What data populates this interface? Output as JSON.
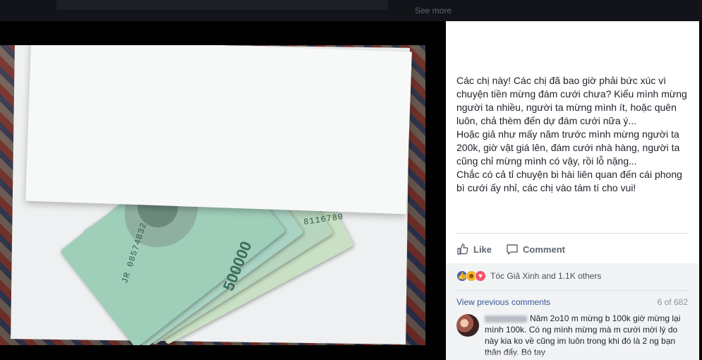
{
  "topbar": {
    "see_more": "See more"
  },
  "photo": {
    "serial_left": "JR 08574832",
    "serial_right": "8116780",
    "denomination": "500000"
  },
  "post": {
    "text": "Các chị này! Các chị đã bao giờ phải bức xúc vì chuyện tiền mừng đám cưới chưa? Kiểu mình mừng người ta nhiều, người ta mừng mình ít, hoặc quên luôn, chả thèm đến dự đám cưới nữa ý...\nHoặc giả như mấy năm trước mình mừng người ta 200k, giờ vật giá lên, đám cưới nhà hàng, người ta cũng chỉ mừng mình có vậy, rồi lỗ nặng...\nChắc có cả tỉ chuyện bi hài liên quan đến cái phong bì cưới ấy nhỉ, các chị vào tám tí cho vui!"
  },
  "actions": {
    "like_label": "Like",
    "comment_label": "Comment",
    "like_icon": "thumbs-up-icon",
    "comment_icon": "speech-bubble-icon"
  },
  "feedback": {
    "reaction_names": "Tóc Giả Xinh and 1.1K others",
    "reaction_icons": [
      "like-reaction-icon",
      "haha-reaction-icon",
      "love-reaction-icon"
    ],
    "view_previous": "View previous comments",
    "comment_count": "6 of 682",
    "comment": {
      "text": "Năm 2o10 m mừng b 100k giờ mừng lại mình 100k. Có ng mình mừng mà m cưới mời lý do này kia ko về cũng im luôn trong khi đó là 2 ng bạn thân đấy. Bó tay"
    }
  },
  "colors": {
    "accent": "#385898",
    "like_blue": "#4267b2",
    "text": "#1d2129",
    "muted": "#606770",
    "panel_bg": "#ffffff",
    "feedback_bg": "#f2f3f5"
  }
}
